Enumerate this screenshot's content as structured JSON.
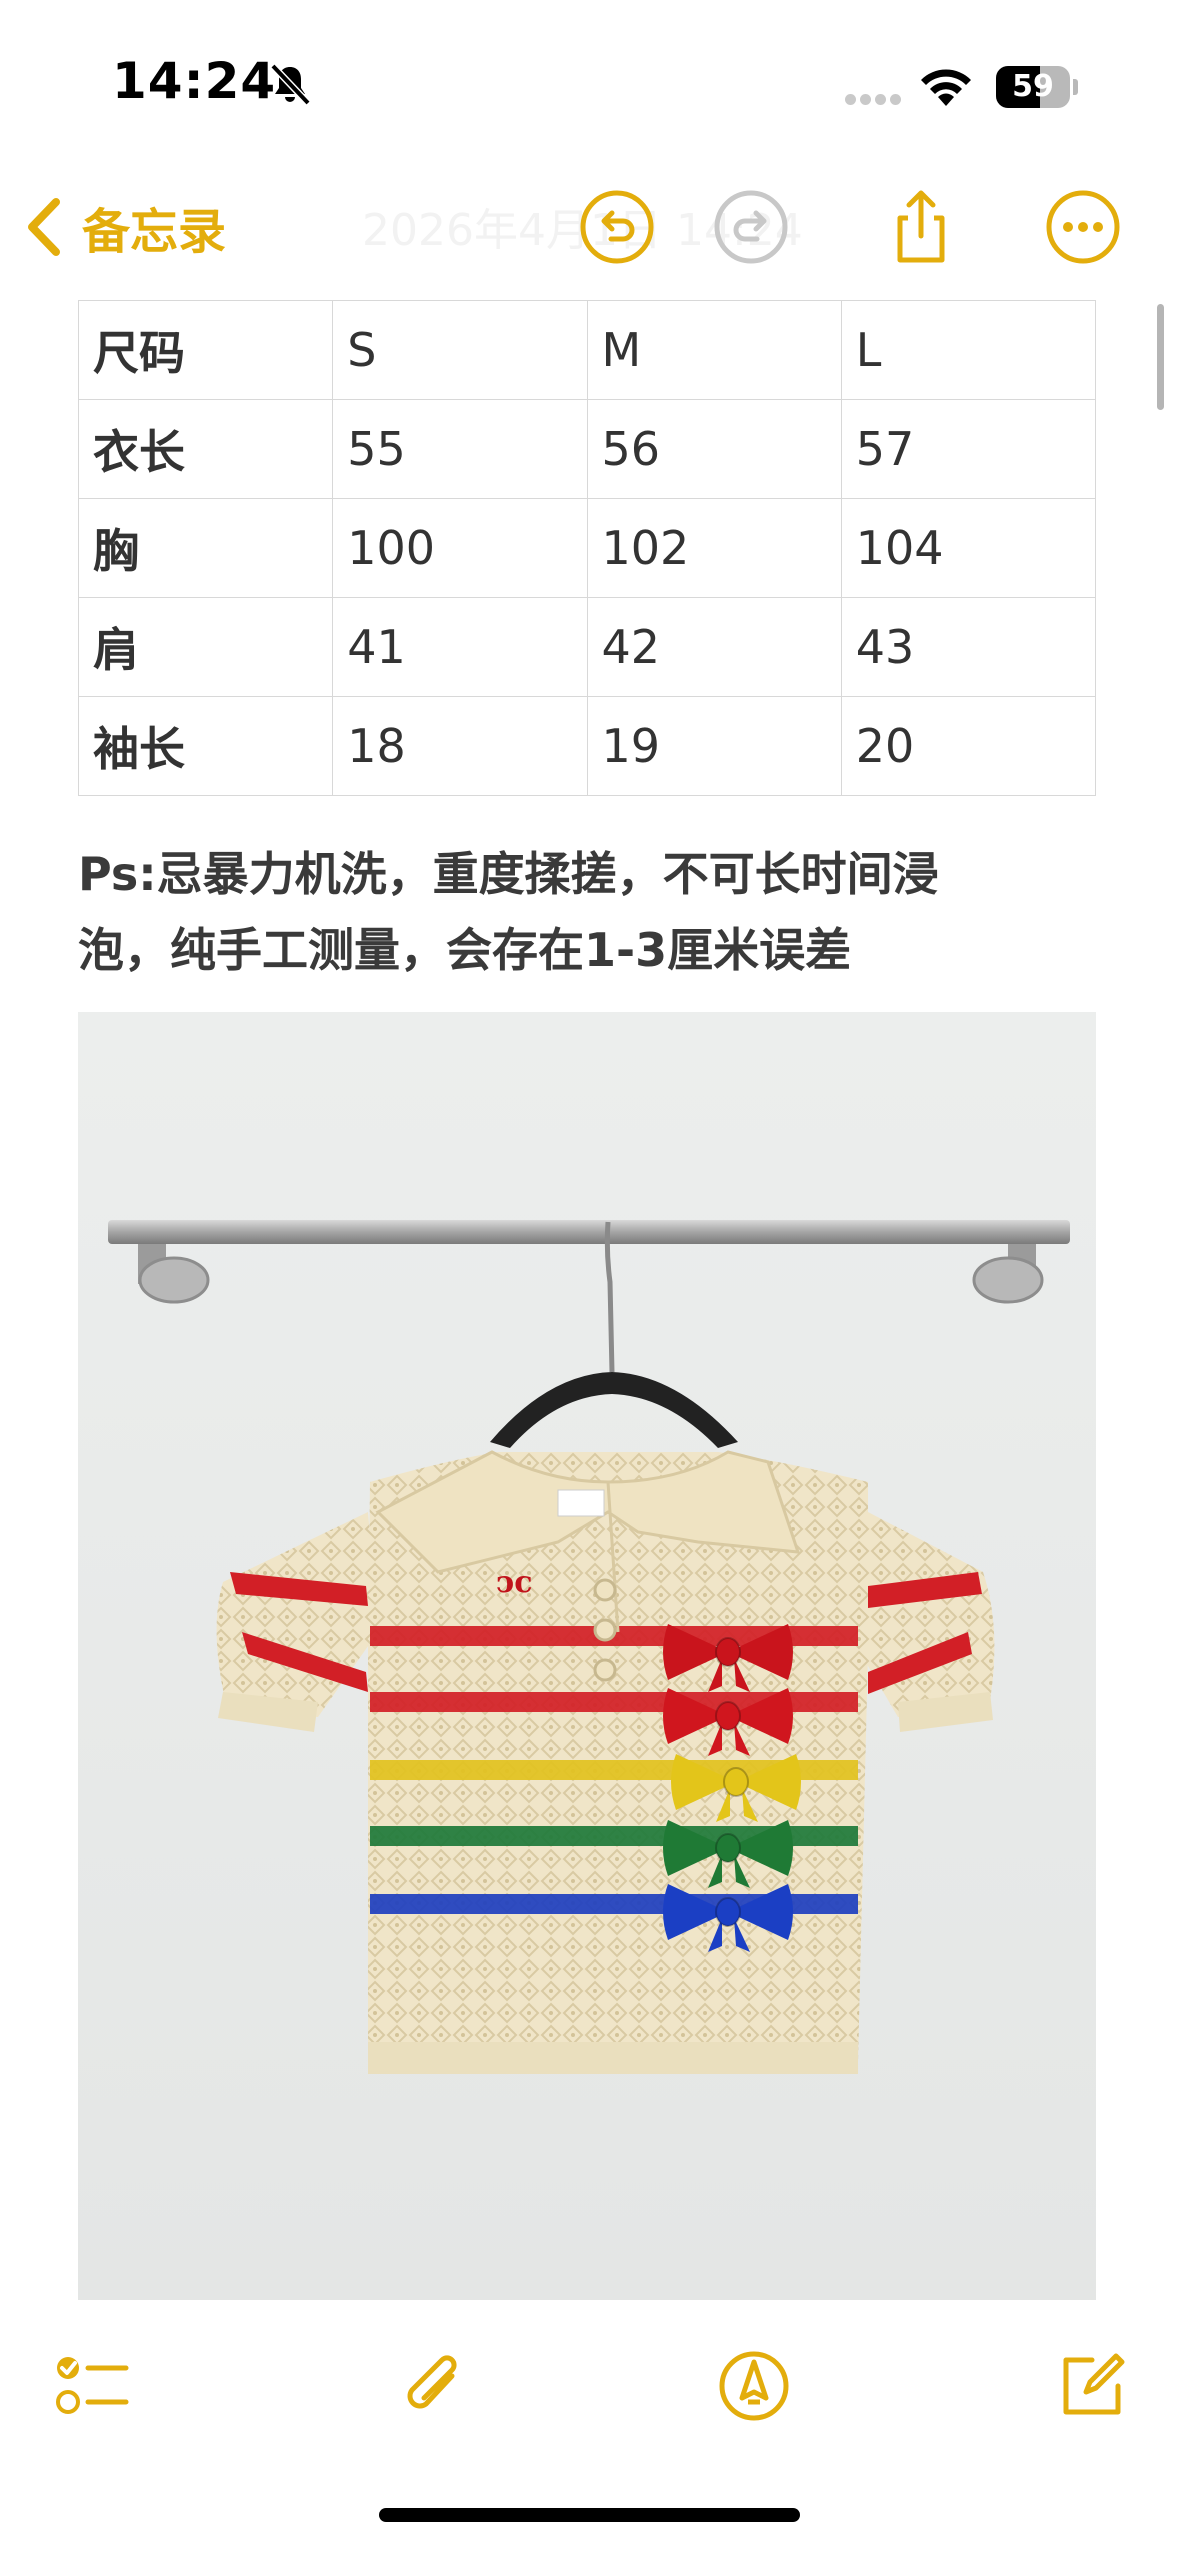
{
  "status_bar": {
    "time": "14:24",
    "battery_level": "59",
    "battery_fraction": 0.59,
    "icons": [
      "bell-slash-icon",
      "cellular-signal-icon",
      "wifi-icon",
      "battery-icon"
    ]
  },
  "nav": {
    "back_label": "备忘录",
    "faded_title": "2026年4月1日 14:24",
    "icons": [
      "chevron-left-icon",
      "undo-icon",
      "redo-icon",
      "share-icon",
      "more-icon"
    ]
  },
  "size_table": {
    "rows": [
      [
        "尺码",
        "S",
        "M",
        "L"
      ],
      [
        "衣长",
        "55",
        "56",
        "57"
      ],
      [
        "胸",
        "100",
        "102",
        "104"
      ],
      [
        "肩",
        "41",
        "42",
        "43"
      ],
      [
        "袖长",
        "18",
        "19",
        "20"
      ]
    ]
  },
  "note": {
    "line1": "Ps:忌暴力机洗，重度揉搓，不可长时间浸",
    "line2": "泡，纯手工测量，会存在1-3厘米误差"
  },
  "photo": {
    "subject": "knit-polo-shirt-photo",
    "stripe_colors": [
      "#d21f26",
      "#d21f26",
      "#e2c21e",
      "#1e7a3a",
      "#1e3fbf"
    ],
    "bow_colors": [
      "#c9141c",
      "#d0161e",
      "#e3c51a",
      "#1f7a35",
      "#1b3fc4"
    ]
  },
  "toolbar": {
    "icons": [
      "checklist-icon",
      "paperclip-icon",
      "markup-pen-icon",
      "compose-icon"
    ]
  },
  "colors": {
    "accent": "#e3ad0c",
    "text": "#333333"
  }
}
